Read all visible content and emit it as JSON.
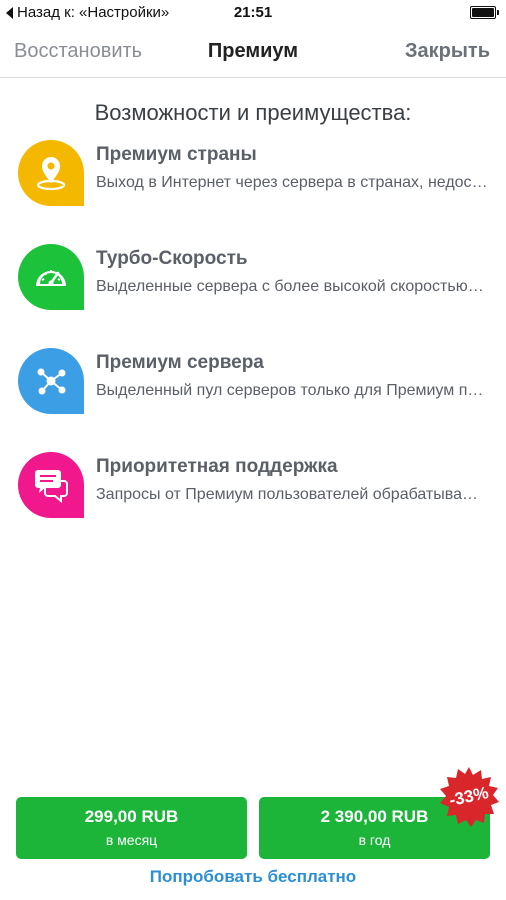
{
  "status_bar": {
    "back_label": "Назад к: «Настройки»",
    "time": "21:51",
    "battery_icon": "battery-icon"
  },
  "nav": {
    "restore_label": "Восстановить",
    "title": "Премиум",
    "close_label": "Закрыть"
  },
  "section_title": "Возможности и преимущества:",
  "features": [
    {
      "title": "Премиум страны",
      "description": "Выход в Интернет через сервера в странах, недоступных в бесплатной версии",
      "icon": "location-pin-icon",
      "color": "#f5b800"
    },
    {
      "title": "Турбо-Скорость",
      "description": "Выделенные сервера с более высокой скоростью соединения",
      "icon": "speedometer-icon",
      "color": "#1cc23a"
    },
    {
      "title": "Премиум сервера",
      "description": "Выделенный пул серверов только для Премиум пользователей",
      "icon": "network-icon",
      "color": "#3c9fe6"
    },
    {
      "title": "Приоритетная поддержка",
      "description": "Запросы от Премиум пользователей обрабатываются в первую очередь",
      "icon": "chat-bubbles-icon",
      "color": "#f0188c"
    }
  ],
  "plans": {
    "month": {
      "price": "299,00 RUB",
      "period": "в месяц"
    },
    "year": {
      "price": "2 390,00 RUB",
      "period": "в год"
    }
  },
  "discount": "-33%",
  "trial_label": "Попробовать бесплатно",
  "colors": {
    "button_green": "#1cb53a",
    "badge_red": "#d9262b",
    "link_blue": "#2a8fd6"
  }
}
